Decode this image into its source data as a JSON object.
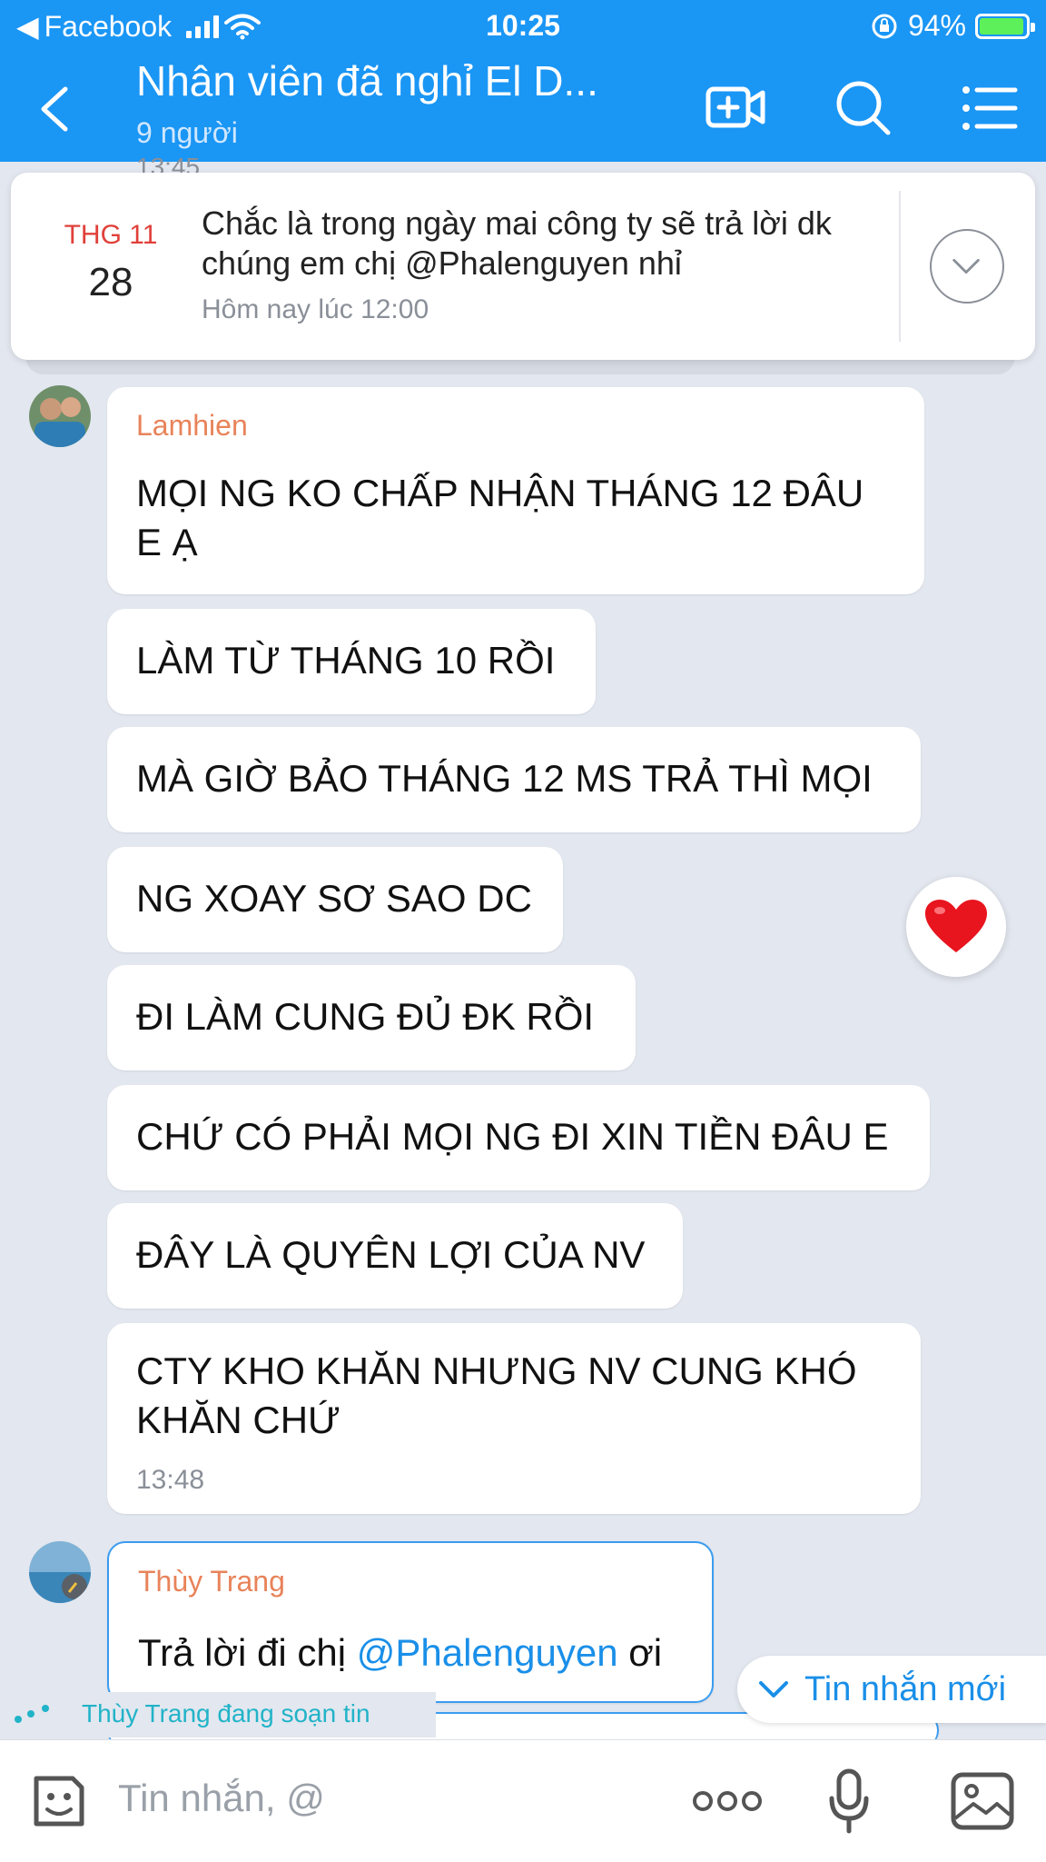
{
  "status_bar": {
    "back_app": "Facebook",
    "time": "10:25",
    "battery": "94%"
  },
  "header": {
    "title": "Nhân viên đã nghỉ El D...",
    "subtitle": "9 người"
  },
  "pinned": {
    "month": "THG 11",
    "day": "28",
    "text": "Chắc là trong ngày mai công ty sẽ trả lời dk chúng em chị @Phalenguyen nhỉ",
    "time": "Hôm nay lúc 12:00",
    "peek_time": "13:45"
  },
  "messages": {
    "sender1": "Lamhien",
    "m1": "MỌI NG KO CHẤP NHẬN THÁNG 12 ĐÂU E Ạ",
    "m2": "LÀM TỪ THÁNG 10 RỒI",
    "m3": "MÀ GIỜ BẢO THÁNG 12 MS TRẢ THÌ MỌI",
    "m4": "NG XOAY SƠ SAO DC",
    "m5": "ĐI LÀM CUNG ĐỦ ĐK RỒI",
    "m6": "CHỨ CÓ PHẢI MỌI NG ĐI XIN TIỀN ĐÂU E",
    "m7": "ĐÂY LÀ QUYÊN LỢI CỦA NV",
    "m8": "CTY KHO KHĂN NHƯNG NV CUNG KHÓ KHĂN CHỨ",
    "m8_time": "13:48",
    "sender2": "Thùy Trang",
    "m9_prefix": "Trả lời đi chị ",
    "m9_mention": "@Phalenguyen",
    "m9_suffix": " ơi"
  },
  "new_message_label": "Tin nhắn mới",
  "typing_text": "Thùy Trang đang soạn tin",
  "composer": {
    "placeholder": "Tin nhắn, @"
  },
  "colors": {
    "header_bg": "#1a96f5",
    "accent": "#1a8fe8",
    "sender_name": "#e8835a",
    "pinned_month": "#e0403a",
    "chat_bg": "#e3e7ef"
  },
  "icons": [
    "back-arrow-icon",
    "video-call-icon",
    "search-icon",
    "menu-icon",
    "chevron-down-icon",
    "heart-icon",
    "sticker-icon",
    "more-icon",
    "microphone-icon",
    "image-icon"
  ]
}
